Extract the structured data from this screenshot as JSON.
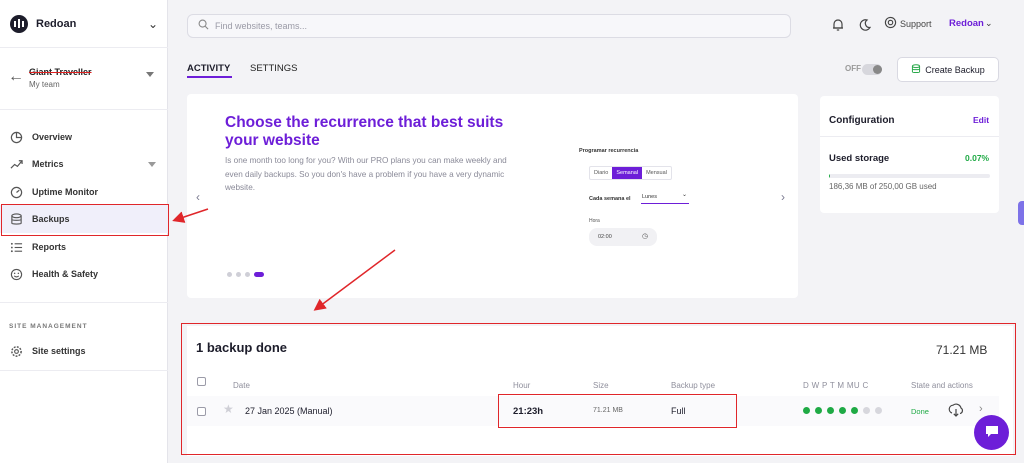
{
  "sidebar": {
    "org_name": "Redoan",
    "site_name": "Giant Traveller",
    "site_team": "My team",
    "items": [
      {
        "label": "Overview",
        "icon": "pie-chart-icon"
      },
      {
        "label": "Metrics",
        "icon": "trend-up-icon"
      },
      {
        "label": "Uptime Monitor",
        "icon": "gauge-icon"
      },
      {
        "label": "Backups",
        "icon": "database-icon"
      },
      {
        "label": "Reports",
        "icon": "list-icon"
      },
      {
        "label": "Health & Safety",
        "icon": "smile-icon"
      }
    ],
    "section_label": "SITE MANAGEMENT",
    "settings_label": "Site settings"
  },
  "topbar": {
    "search_placeholder": "Find websites, teams...",
    "support_label": "Support",
    "user_name": "Redoan"
  },
  "tabs": [
    "ACTIVITY",
    "SETTINGS"
  ],
  "toolbar": {
    "toggle_label": "OFF",
    "create_backup_label": "Create Backup"
  },
  "carousel": {
    "title": "Choose the recurrence that best suits your website",
    "text": "Is one month too long for you? With our PRO plans you can make weekly and even daily backups. So you don's have a problem if you have a very dynamic website.",
    "mini": {
      "title": "Programar recurrencia",
      "options": [
        "Diario",
        "Semanal",
        "Mensual"
      ],
      "selected": "Semanal",
      "each_week_label": "Cada semana el",
      "day_value": "Lunes",
      "hour_label": "Hora",
      "time_value": "02:00"
    }
  },
  "config": {
    "title": "Configuration",
    "edit_label": "Edit",
    "storage_label": "Used storage",
    "storage_pct": "0.07%",
    "storage_fraction": 0.0007,
    "storage_detail": "186,36 MB of 250,00 GB used"
  },
  "backups": {
    "title": "1 backup done",
    "total_size": "71.21 MB",
    "columns": {
      "date": "Date",
      "hour": "Hour",
      "size": "Size",
      "type": "Backup type",
      "days": "D W P T M MU C",
      "state": "State and actions"
    },
    "rows": [
      {
        "date": "27 Jan 2025 (Manual)",
        "hour": "21:23h",
        "size": "71.21 MB",
        "type": "Full",
        "state": "Done",
        "retention": [
          "#1faa45",
          "#1faa45",
          "#1faa45",
          "#1faa45",
          "#1faa45",
          "#d7d7dd",
          "#d7d7dd"
        ]
      }
    ]
  },
  "colors": {
    "accent": "#6d1ed8",
    "success": "#1faa45",
    "annotation": "#e0262a"
  }
}
